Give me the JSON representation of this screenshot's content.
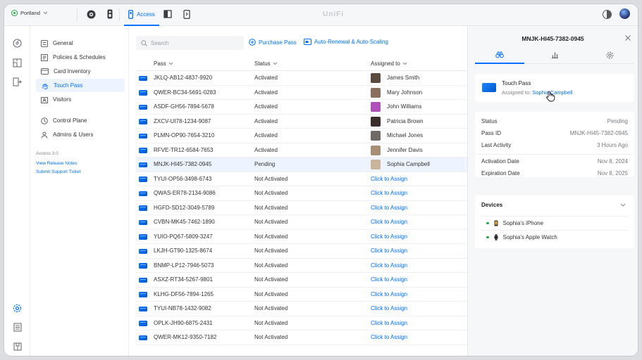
{
  "topbar": {
    "site": "Portland",
    "access_tab": "Access",
    "brand": "UniFi"
  },
  "nav": {
    "items": [
      {
        "label": "General",
        "icon": "general-icon"
      },
      {
        "label": "Policies & Schedules",
        "icon": "policies-icon"
      },
      {
        "label": "Card Inventory",
        "icon": "card-inventory-icon"
      },
      {
        "label": "Touch Pass",
        "icon": "touch-pass-icon",
        "active": true
      },
      {
        "label": "Visitors",
        "icon": "visitors-icon"
      },
      {
        "label": "Control Plane",
        "icon": "control-plane-icon"
      },
      {
        "label": "Admins & Users",
        "icon": "admins-icon"
      }
    ],
    "version": "Access 3.0",
    "links": [
      "View Release Notes",
      "Submit Support Ticket"
    ]
  },
  "toolbar": {
    "search_placeholder": "Search",
    "purchase": "Purchase Pass",
    "autorenew": "Auto-Renewal & Auto-Scaling"
  },
  "table": {
    "headers": {
      "pass": "Pass",
      "status": "Status",
      "assigned": "Assigned to"
    },
    "rows": [
      {
        "pass": "JKLQ-AB12-4837-9920",
        "status": "Activated",
        "assigned": "James Smith",
        "face": "#5a4a3f"
      },
      {
        "pass": "QWER-BC34-5691-0283",
        "status": "Activated",
        "assigned": "Mary Johnson",
        "face": "#8a6e5e"
      },
      {
        "pass": "ASDF-GH56-7894-5678",
        "status": "Activated",
        "assigned": "John Williams",
        "face": "#b04fb8"
      },
      {
        "pass": "ZXCV-UI78-1234-9087",
        "status": "Activated",
        "assigned": "Patricia Brown",
        "face": "#3b2e2a"
      },
      {
        "pass": "PLMN-OP90-7654-3210",
        "status": "Activated",
        "assigned": "Michael Jones",
        "face": "#6f6a66"
      },
      {
        "pass": "RFVE-TR12-6584-7653",
        "status": "Activated",
        "assigned": "Jennifer Davis",
        "face": "#a88f73"
      },
      {
        "pass": "MNJK-HI45-7382-0945",
        "status": "Pending",
        "assigned": "Sophia Campbell",
        "face": "#c9b59c",
        "selected": true
      },
      {
        "pass": "TYUI-OP56-3498-6743",
        "status": "Not Activated",
        "assigned": "Click to Assign"
      },
      {
        "pass": "QWAS-ER78-2134-9086",
        "status": "Not Activated",
        "assigned": "Click to Assign"
      },
      {
        "pass": "HGFD-SD12-3049-5789",
        "status": "Not Activated",
        "assigned": "Click to Assign"
      },
      {
        "pass": "CVBN-MK45-7462-1890",
        "status": "Not Activated",
        "assigned": "Click to Assign"
      },
      {
        "pass": "YUIO-PQ67-5809-3247",
        "status": "Not Activated",
        "assigned": "Click to Assign"
      },
      {
        "pass": "LKJH-GT90-1325-8674",
        "status": "Not Activated",
        "assigned": "Click to Assign"
      },
      {
        "pass": "BNMP-LP12-7946-5073",
        "status": "Not Activated",
        "assigned": "Click to Assign"
      },
      {
        "pass": "ASXZ-RT34-5267-9801",
        "status": "Not Activated",
        "assigned": "Click to Assign"
      },
      {
        "pass": "KLHG-DF56-7894-1265",
        "status": "Not Activated",
        "assigned": "Click to Assign"
      },
      {
        "pass": "TYUI-NB78-1432-9082",
        "status": "Not Activated",
        "assigned": "Click to Assign"
      },
      {
        "pass": "OPLK-JH90-6875-2431",
        "status": "Not Activated",
        "assigned": "Click to Assign"
      },
      {
        "pass": "QWER-MK12-9350-7182",
        "status": "Not Activated",
        "assigned": "Click to Assign"
      }
    ]
  },
  "panel": {
    "title": "MNJK-HI45-7382-0945",
    "pass_type": "Touch Pass",
    "assigned_prefix": "Assigned to: ",
    "assigned_name": "Sophia Campbell",
    "details": [
      {
        "key": "Status",
        "value": "Pending"
      },
      {
        "key": "Pass ID",
        "value": "MNJK-HI45-7382-0945"
      },
      {
        "key": "Last Activity",
        "value": "3 Hours Ago"
      },
      {
        "key": "Activation Date",
        "value": "Nov 8, 2024"
      },
      {
        "key": "Expiration Date",
        "value": "Nov 8, 2025"
      }
    ],
    "devices_title": "Devices",
    "devices": [
      {
        "name": "Sophia's iPhone",
        "icon": "phone-icon"
      },
      {
        "name": "Sophia's Apple Watch",
        "icon": "watch-icon"
      }
    ]
  },
  "colors": {
    "accent": "#006fff",
    "online": "#27a548"
  }
}
